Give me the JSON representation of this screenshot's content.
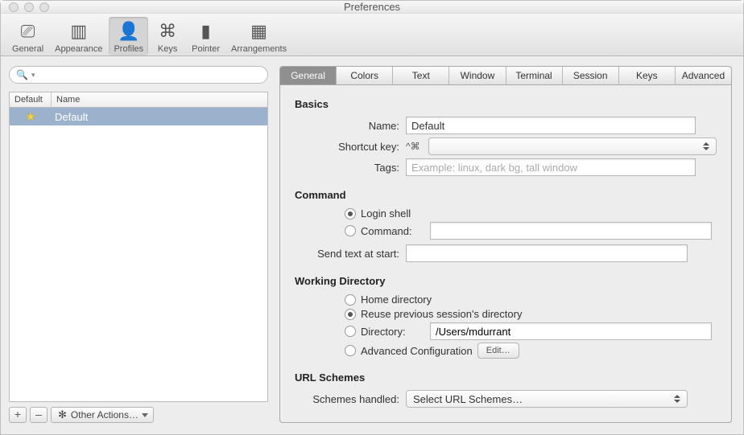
{
  "window": {
    "title": "Preferences"
  },
  "toolbar": {
    "items": [
      {
        "label": "General",
        "icon": "⎚"
      },
      {
        "label": "Appearance",
        "icon": "▥"
      },
      {
        "label": "Profiles",
        "icon": "👤",
        "active": true
      },
      {
        "label": "Keys",
        "icon": "⌘"
      },
      {
        "label": "Pointer",
        "icon": "▮"
      },
      {
        "label": "Arrangements",
        "icon": "▦"
      }
    ]
  },
  "profiles": {
    "search_placeholder": "",
    "columns": {
      "c1": "Default",
      "c2": "Name"
    },
    "items": [
      {
        "name": "Default",
        "starred": true,
        "selected": true
      }
    ],
    "footer": {
      "add": "+",
      "remove": "–",
      "other_actions": "Other Actions…"
    }
  },
  "tabs": [
    "General",
    "Colors",
    "Text",
    "Window",
    "Terminal",
    "Session",
    "Keys",
    "Advanced"
  ],
  "active_tab": "General",
  "general": {
    "basics_title": "Basics",
    "name_label": "Name:",
    "name_value": "Default",
    "shortcut_label": "Shortcut key:",
    "shortcut_prefix": "^⌘",
    "shortcut_value": "",
    "tags_label": "Tags:",
    "tags_value": "",
    "tags_placeholder": "Example: linux, dark bg, tall window",
    "command_title": "Command",
    "command_radio": "login",
    "login_shell_label": "Login shell",
    "command_label": "Command:",
    "command_value": "",
    "send_text_label": "Send text at start:",
    "send_text_value": "",
    "wd_title": "Working Directory",
    "wd_radio": "reuse",
    "home_label": "Home directory",
    "reuse_label": "Reuse previous session's directory",
    "directory_label": "Directory:",
    "directory_value": "/Users/mdurrant",
    "advcfg_label": "Advanced Configuration",
    "edit_button": "Edit…",
    "url_title": "URL Schemes",
    "schemes_label": "Schemes handled:",
    "schemes_value": "Select URL Schemes…"
  }
}
